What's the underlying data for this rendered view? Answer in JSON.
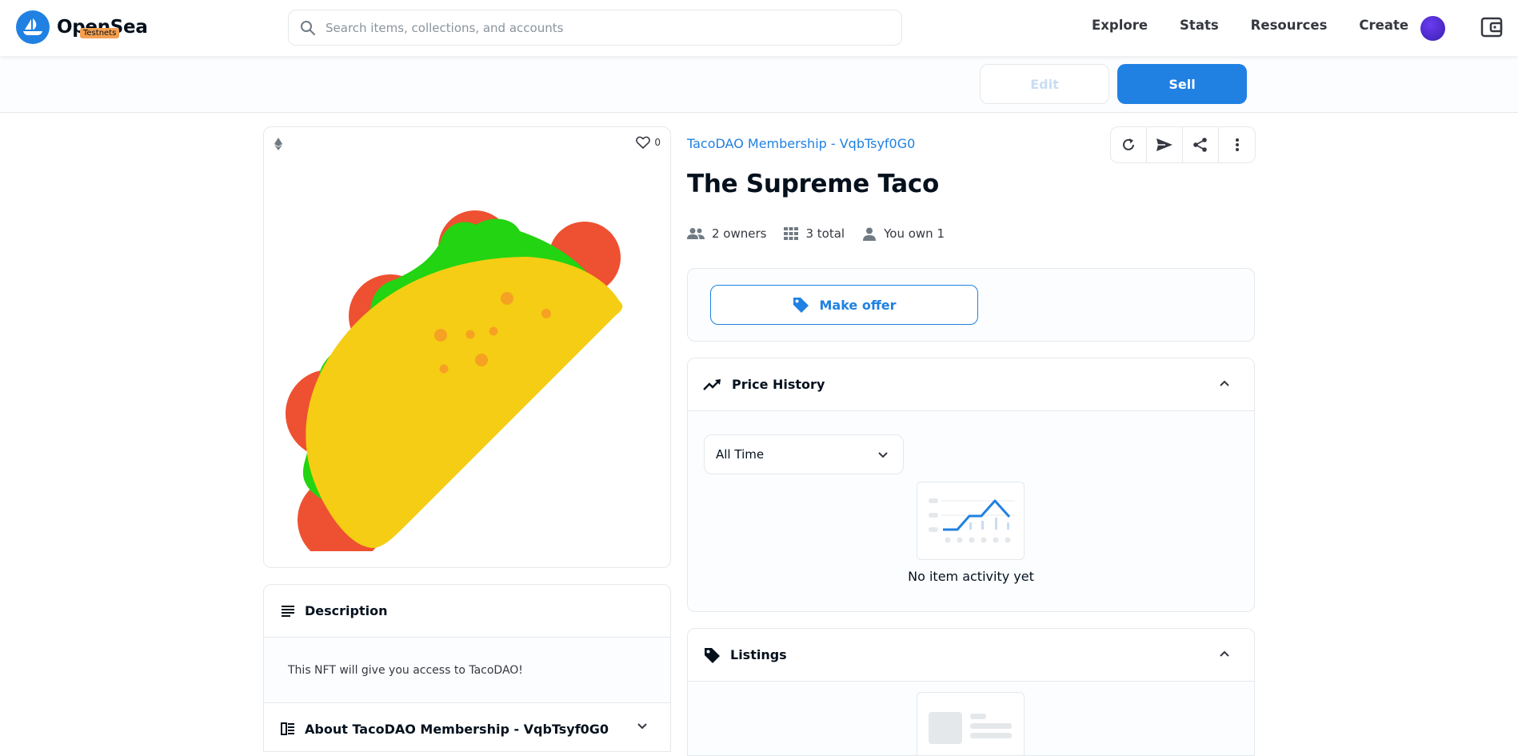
{
  "header": {
    "brand": "OpenSea",
    "badge": "Testnets",
    "search_placeholder": "Search items, collections, and accounts",
    "nav": [
      "Explore",
      "Stats",
      "Resources",
      "Create"
    ]
  },
  "actions": {
    "edit_label": "Edit",
    "sell_label": "Sell"
  },
  "item": {
    "collection": "TacoDAO Membership - VqbTsyf0G0",
    "title": "The Supreme Taco",
    "favorites": "0",
    "owners": "2 owners",
    "total": "3 total",
    "you_own": "You own 1"
  },
  "offer": {
    "label": "Make offer"
  },
  "price_history": {
    "title": "Price History",
    "range": "All Time",
    "empty": "No item activity yet"
  },
  "listings": {
    "title": "Listings"
  },
  "description": {
    "title": "Description",
    "text": "This NFT will give you access to TacoDAO!",
    "about_title": "About TacoDAO Membership - VqbTsyf0G0"
  },
  "colors": {
    "accent": "#2081e2",
    "taco_shell": "#f5cd14",
    "lettuce": "#22d411",
    "tomato": "#ee5131"
  }
}
